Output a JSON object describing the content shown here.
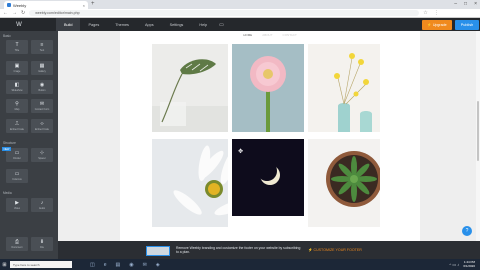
{
  "browser": {
    "tab_title": "Weebly",
    "tab_close": "×",
    "new_tab": "+",
    "window_controls": [
      "–",
      "□",
      "×"
    ],
    "url": "weebly.com/editor/main.php",
    "nav_back": "←",
    "nav_forward": "→",
    "nav_reload": "↻",
    "star": "☆",
    "more": "⋮"
  },
  "editor": {
    "logo": "W",
    "menu": [
      {
        "label": "Build",
        "active": true
      },
      {
        "label": "Pages",
        "active": false
      },
      {
        "label": "Themes",
        "active": false
      },
      {
        "label": "Apps",
        "active": false
      },
      {
        "label": "Settings",
        "active": false
      },
      {
        "label": "Help",
        "active": false
      }
    ],
    "device_icon": "▭",
    "upgrade_label": "⚡ Upgrade",
    "publish_label": "Publish"
  },
  "sidebar": {
    "sections": [
      {
        "label": "Basic",
        "elements": [
          {
            "icon": "T",
            "label": "Title"
          },
          {
            "icon": "≡",
            "label": "Text"
          },
          {
            "icon": "▣",
            "label": "Image"
          },
          {
            "icon": "▦",
            "label": "Gallery"
          },
          {
            "icon": "◧",
            "label": "Slideshow"
          },
          {
            "icon": "◉",
            "label": "Button"
          },
          {
            "icon": "⚲",
            "label": "Map"
          },
          {
            "icon": "✉",
            "label": "Contact Form"
          },
          {
            "icon": "⎍",
            "label": "Embed Code"
          },
          {
            "icon": "‹›",
            "label": "Embed Code"
          }
        ]
      },
      {
        "label": "Structure",
        "elements": [
          {
            "icon": "▭",
            "label": "Divider"
          },
          {
            "icon": "⊹",
            "label": "Spacer"
          },
          {
            "icon": "▭",
            "label": "Columns"
          }
        ]
      },
      {
        "label": "Media",
        "elements": [
          {
            "icon": "▶",
            "label": "Video"
          },
          {
            "icon": "♪",
            "label": "Audio"
          },
          {
            "icon": "⎙",
            "label": "Document"
          },
          {
            "icon": "⬇",
            "label": "File"
          }
        ]
      }
    ],
    "new_badge": "NEW"
  },
  "page": {
    "subnav": [
      {
        "label": "HOME",
        "active": true
      },
      {
        "label": "ABOUT",
        "active": false
      },
      {
        "label": "CONTACT",
        "active": false
      }
    ]
  },
  "footer_banner": {
    "text": "Remove Weebly branding and customize the footer on your website by subscribing to a plan.",
    "link": "⚡ CUSTOMIZE YOUR FOOTER"
  },
  "help_icon": "?",
  "taskbar": {
    "start": "⊞",
    "search_placeholder": "Type here to search",
    "time": "1:44 PM",
    "date": "6/1/2020",
    "tray": "^ ▭ ♪",
    "app_icons": [
      "◫",
      "e",
      "▤",
      "◉",
      "✉",
      "◈"
    ]
  }
}
